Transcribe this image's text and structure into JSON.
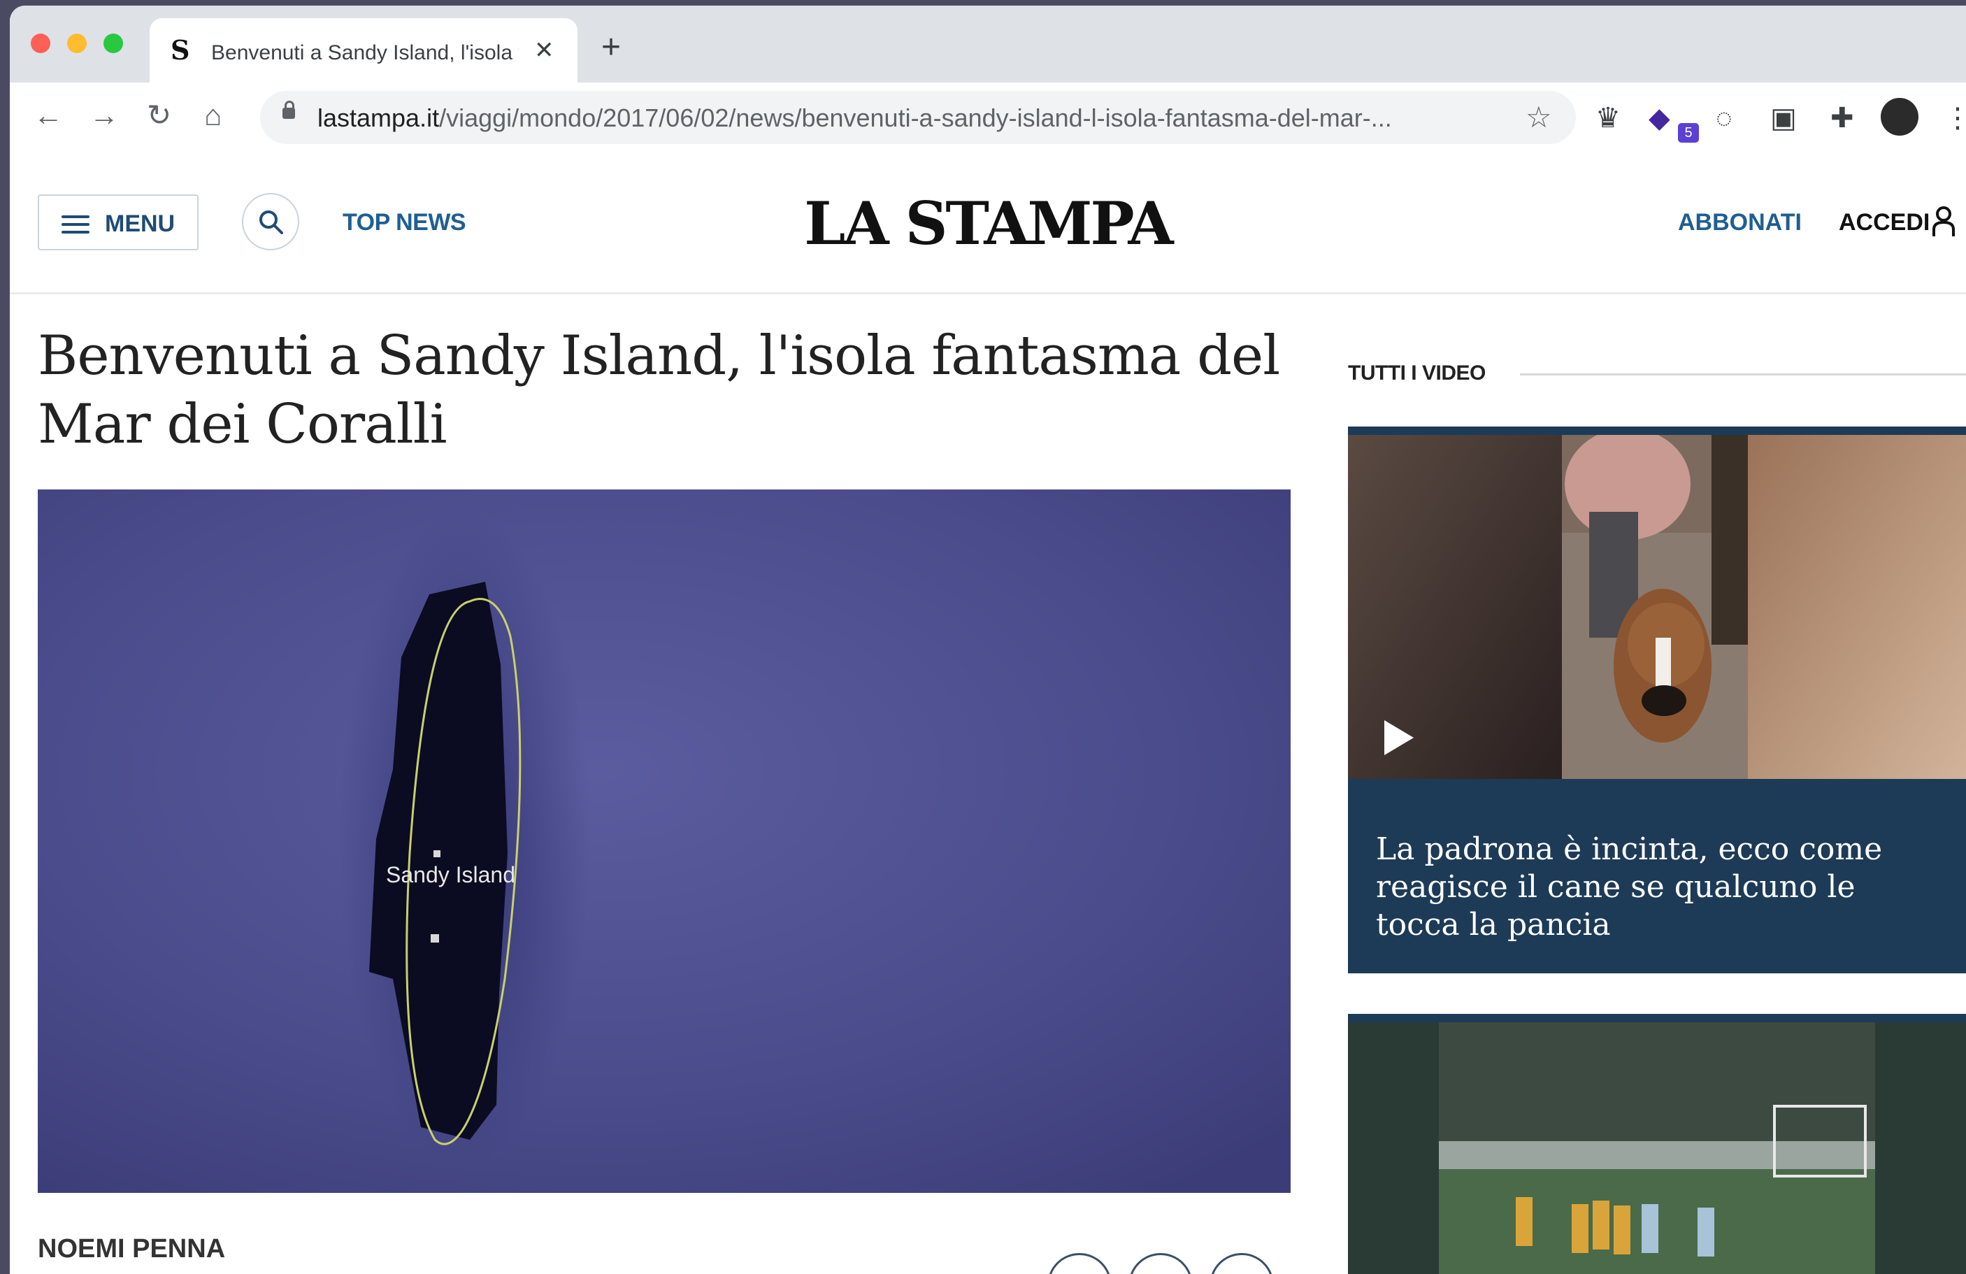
{
  "browser": {
    "tab": {
      "favicon": "S",
      "title": "Benvenuti a Sandy Island, l'isola fantasma del Mar dei Coralli"
    },
    "new_tab": "+",
    "url": {
      "host": "lastampa.it",
      "path": "/viaggi/mondo/2017/06/02/news/benvenuti-a-sandy-island-l-isola-fantasma-del-mar-..."
    },
    "extension_badge": "5"
  },
  "site": {
    "menu_label": "MENU",
    "top_news": "TOP NEWS",
    "logo": "LA STAMPA",
    "subscribe": "ABBONATI",
    "login": "ACCEDI"
  },
  "article": {
    "headline": "Benvenuti a Sandy Island, l'isola fantasma del Mar dei Coralli",
    "image_label": "Sandy Island",
    "author": "NOEMI PENNA"
  },
  "sidebar": {
    "section_title": "TUTTI I VIDEO",
    "videos": [
      {
        "title": "La padrona è incinta, ecco come reagisce il cane se qualcuno le tocca la pancia"
      }
    ]
  },
  "colors": {
    "brand_blue": "#1f5e92",
    "video_card_bg": "#1d3b57",
    "ocean": "#4e4f92"
  }
}
